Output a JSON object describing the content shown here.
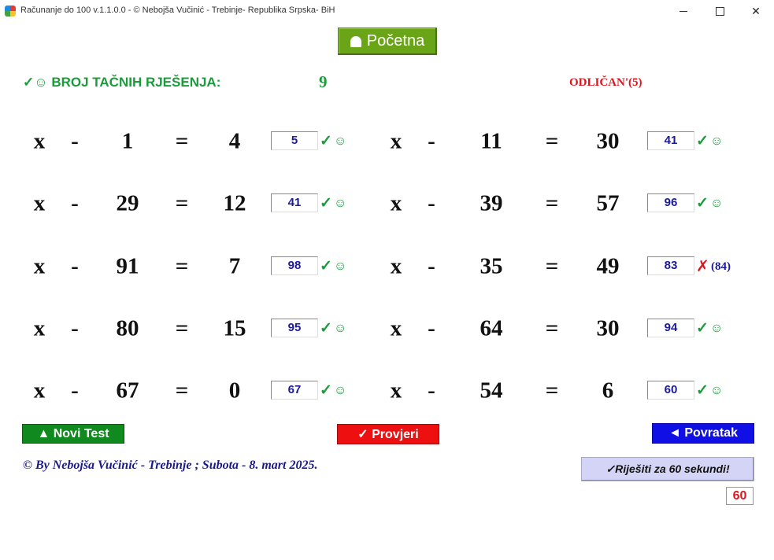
{
  "window": {
    "title": "Računanje do 100 v.1.1.0.0 - © Nebojša Vučinić - Trebinje- Republika Srpska- BiH",
    "icons": {
      "app": "app-logo-icon",
      "minimize": "minimize-icon",
      "maximize": "maximize-icon",
      "close": "close-icon"
    },
    "close_glyph": "✕"
  },
  "home_button": {
    "label": "Početna",
    "icon": "home-icon"
  },
  "score": {
    "label": "✓☺ BROJ TAČNIH RJEŠENJA:",
    "value": "9"
  },
  "grade": "ODLIČAN'(5)",
  "problems": [
    {
      "var": "x",
      "op": "-",
      "b": "1",
      "eq": "=",
      "c": "4",
      "answer": "5",
      "ok": true,
      "mark": "✓",
      "smile": "☺"
    },
    {
      "var": "x",
      "op": "-",
      "b": "11",
      "eq": "=",
      "c": "30",
      "answer": "41",
      "ok": true,
      "mark": "✓",
      "smile": "☺"
    },
    {
      "var": "x",
      "op": "-",
      "b": "29",
      "eq": "=",
      "c": "12",
      "answer": "41",
      "ok": true,
      "mark": "✓",
      "smile": "☺"
    },
    {
      "var": "x",
      "op": "-",
      "b": "39",
      "eq": "=",
      "c": "57",
      "answer": "96",
      "ok": true,
      "mark": "✓",
      "smile": "☺"
    },
    {
      "var": "x",
      "op": "-",
      "b": "91",
      "eq": "=",
      "c": "7",
      "answer": "98",
      "ok": true,
      "mark": "✓",
      "smile": "☺"
    },
    {
      "var": "x",
      "op": "-",
      "b": "35",
      "eq": "=",
      "c": "49",
      "answer": "83",
      "ok": false,
      "mark": "✗",
      "correct": "(84)"
    },
    {
      "var": "x",
      "op": "-",
      "b": "80",
      "eq": "=",
      "c": "15",
      "answer": "95",
      "ok": true,
      "mark": "✓",
      "smile": "☺"
    },
    {
      "var": "x",
      "op": "-",
      "b": "64",
      "eq": "=",
      "c": "30",
      "answer": "94",
      "ok": true,
      "mark": "✓",
      "smile": "☺"
    },
    {
      "var": "x",
      "op": "-",
      "b": "67",
      "eq": "=",
      "c": "0",
      "answer": "67",
      "ok": true,
      "mark": "✓",
      "smile": "☺"
    },
    {
      "var": "x",
      "op": "-",
      "b": "54",
      "eq": "=",
      "c": "6",
      "answer": "60",
      "ok": true,
      "mark": "✓",
      "smile": "☺"
    }
  ],
  "buttons": {
    "new_test": "▲ Novi Test",
    "check": "✓ Provjeri",
    "back": "◄ Povratak",
    "timed": "✓Riješiti za 60 sekundi!"
  },
  "footer": "© By Nebojša Vučinić - Trebinje ; Subota - 8. mart 2025.",
  "timer": "60",
  "colors": {
    "green": "#1a9c3a",
    "red": "#e0141e",
    "navy": "#1a1a9c",
    "home_btn": "#6aa517",
    "new_btn": "#108a1e",
    "check_btn": "#ee1010",
    "back_btn": "#1010e6"
  }
}
